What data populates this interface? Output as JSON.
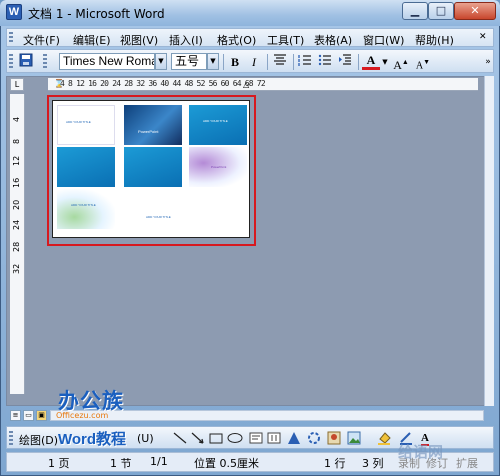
{
  "window": {
    "title": "文档 1 - Microsoft Word",
    "app_icon": "W",
    "minimize": "▁",
    "maximize": "□",
    "close": "✕"
  },
  "menu": [
    "文件(F)",
    "编辑(E)",
    "视图(V)",
    "插入(I)",
    "格式(O)",
    "工具(T)",
    "表格(A)",
    "窗口(W)",
    "帮助(H)"
  ],
  "toolbar": {
    "font_name": "Times New Roman",
    "font_size": "五号",
    "bold": "B",
    "italic": "I",
    "font_color_label": "A",
    "grow_font": "A",
    "shrink_font": "A"
  },
  "ruler": {
    "corner": "L",
    "h_marks": "4 8 12 16 20 24 28 32 36 40 44 48 52 56 60 64 68 72",
    "v_marks": [
      "4",
      "8",
      "12",
      "16",
      "20",
      "24",
      "28",
      "32"
    ]
  },
  "slides": {
    "label_powerpoint": "PowerPoint",
    "label_small": "ADD YOUR TITLE"
  },
  "drawbar": {
    "draw": "绘图(D)",
    "autoshape": "(U)"
  },
  "status": {
    "page": "1 页",
    "section": "1 节",
    "page_of": "1/1",
    "position": "位置 0.5厘米",
    "line": "1 行",
    "column": "3 列",
    "rec": "录制",
    "trk": "修订",
    "ext": "扩展"
  },
  "watermark": {
    "brand": "办公族",
    "url": "Officezu.com",
    "word_tutorial": "Word教程",
    "right_mark": "给语网"
  },
  "colors": {
    "highlight": "#d7191f",
    "font_color": "#d7191f",
    "watermark": "#1a5fbf"
  }
}
